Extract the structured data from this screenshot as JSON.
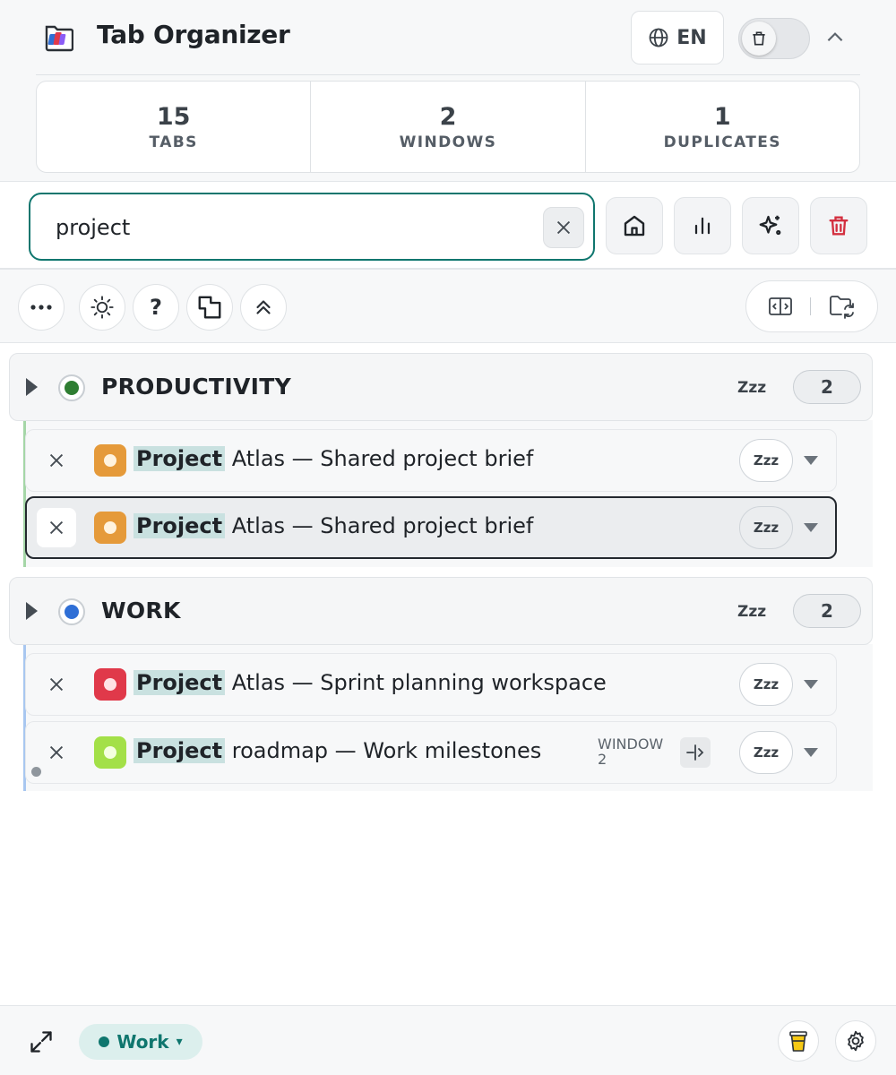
{
  "header": {
    "title": "Tab Organizer",
    "language_label": "EN",
    "language_icon": "globe-icon",
    "toggle_icon": "trash-icon",
    "collapse_icon": "chevron-up-icon"
  },
  "stats": [
    {
      "value": "15",
      "label": "TABS"
    },
    {
      "value": "2",
      "label": "WINDOWS"
    },
    {
      "value": "1",
      "label": "DUPLICATES"
    }
  ],
  "search": {
    "value": "project",
    "placeholder": "",
    "clear_icon": "close-icon"
  },
  "action_buttons": [
    "home-icon",
    "bar-chart-icon",
    "sparkles-icon",
    "trash-icon"
  ],
  "toolbar": {
    "left_icons": [
      "more-icon",
      "sun-icon",
      "help-icon",
      "copy-windows-icon",
      "chevrons-up-icon"
    ],
    "help_glyph": "?",
    "right_icons": [
      "split-view-icon",
      "folder-sync-icon"
    ]
  },
  "groups": [
    {
      "name": "PRODUCTIVITY",
      "color": "#2e7d32",
      "accent": "#a5d6a7",
      "snooze_label": "Zzz",
      "count": "2",
      "tabs": [
        {
          "highlight": "Project",
          "rest": " Atlas — Shared project brief",
          "favicon_color": "#e59a3a",
          "snooze_label": "Zzz",
          "active": false
        },
        {
          "highlight": "Project",
          "rest": " Atlas — Shared project brief",
          "favicon_color": "#e59a3a",
          "snooze_label": "Zzz",
          "active": true
        }
      ]
    },
    {
      "name": "WORK",
      "color": "#2f6fd6",
      "accent": "#a8c7f0",
      "snooze_label": "Zzz",
      "count": "2",
      "tabs": [
        {
          "highlight": "Project",
          "rest": " Atlas — Sprint planning workspace",
          "favicon_color": "#e0394a",
          "snooze_label": "Zzz",
          "active": false
        },
        {
          "highlight": "Project",
          "rest": " roadmap — Work milestones",
          "favicon_color": "#a3e048",
          "snooze_label": "Zzz",
          "active": false,
          "window_label": "WINDOW",
          "window_number": "2"
        }
      ]
    }
  ],
  "footer": {
    "workspace_label": "Work",
    "workspace_caret": "▾",
    "workspace_color": "#0f766e",
    "icons": [
      "expand-icon",
      "cup-icon",
      "gear-icon"
    ]
  }
}
